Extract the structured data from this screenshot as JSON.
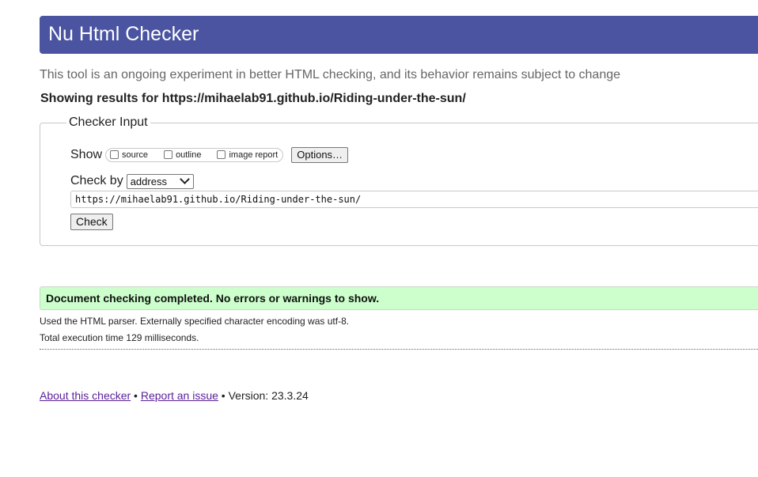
{
  "header": {
    "title": "Nu Html Checker"
  },
  "tagline": "This tool is an ongoing experiment in better HTML checking, and its behavior remains subject to change",
  "results_heading": "Showing results for https://mihaelab91.github.io/Riding-under-the-sun/",
  "checker_input": {
    "legend": "Checker Input",
    "show_label": "Show",
    "options": [
      {
        "label": "source",
        "checked": false
      },
      {
        "label": "outline",
        "checked": false
      },
      {
        "label": "image report",
        "checked": false
      }
    ],
    "options_button": "Options…",
    "check_by_label": "Check by",
    "check_by_selected": "address",
    "url_value": "https://mihaelab91.github.io/Riding-under-the-sun/",
    "check_button": "Check"
  },
  "result": {
    "message": "Document checking completed. No errors or warnings to show.",
    "parser_info": "Used the HTML parser. Externally specified character encoding was utf-8.",
    "execution_time": "Total execution time 129 milliseconds."
  },
  "footer": {
    "about_link": "About this checker",
    "separator": " • ",
    "report_link": "Report an issue",
    "version_text": "Version: 23.3.24"
  },
  "colors": {
    "header_bg": "#4a54a0",
    "success_bg": "#ccffcc",
    "link_visited": "#5a1f9a"
  }
}
